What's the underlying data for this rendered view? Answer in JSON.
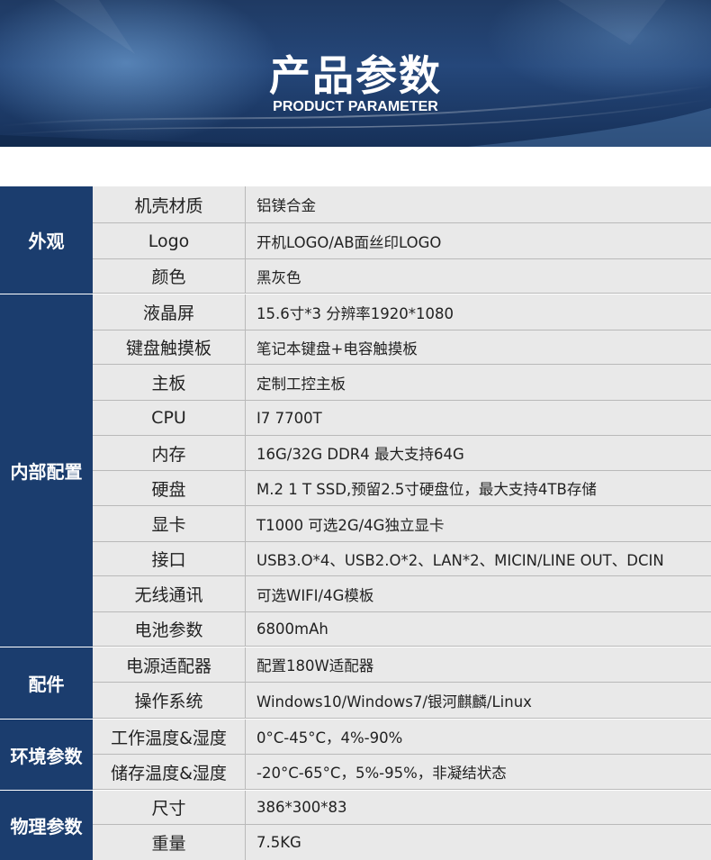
{
  "header": {
    "title": "产品参数",
    "subtitle": "PRODUCT PARAMETER"
  },
  "spec_groups": [
    {
      "category": "外观",
      "rows": [
        {
          "label": "机壳材质",
          "value": "铝镁合金"
        },
        {
          "label": "Logo",
          "value": "开机LOGO/AB面丝印LOGO"
        },
        {
          "label": "颜色",
          "value": "黑灰色"
        }
      ]
    },
    {
      "category": "内部配置",
      "rows": [
        {
          "label": "液晶屏",
          "value": "15.6寸*3 分辨率1920*1080"
        },
        {
          "label": "键盘触摸板",
          "value": "笔记本键盘+电容触摸板"
        },
        {
          "label": "主板",
          "value": "定制工控主板"
        },
        {
          "label": "CPU",
          "value": "I7 7700T"
        },
        {
          "label": "内存",
          "value": "16G/32G DDR4 最大支持64G"
        },
        {
          "label": "硬盘",
          "value": "M.2 1 T SSD,预留2.5寸硬盘位，最大支持4TB存储"
        },
        {
          "label": "显卡",
          "value": "T1000 可选2G/4G独立显卡"
        },
        {
          "label": "接口",
          "value": "USB3.O*4、USB2.O*2、LAN*2、MICIN/LINE OUT、DCIN"
        },
        {
          "label": "无线通讯",
          "value": "可选WIFI/4G模板"
        },
        {
          "label": "电池参数",
          "value": "6800mAh"
        }
      ]
    },
    {
      "category": "配件",
      "rows": [
        {
          "label": "电源适配器",
          "value": "配置180W适配器"
        },
        {
          "label": "操作系统",
          "value": "Windows10/Windows7/银河麒麟/Linux"
        }
      ]
    },
    {
      "category": "环境参数",
      "rows": [
        {
          "label": "工作温度&湿度",
          "value": "0°C-45°C，4%-90%"
        },
        {
          "label": "储存温度&湿度",
          "value": "-20°C-65°C，5%-95%，非凝结状态"
        }
      ]
    },
    {
      "category": "物理参数",
      "rows": [
        {
          "label": "尺寸",
          "value": "386*300*83"
        },
        {
          "label": "重量",
          "value": "7.5KG"
        }
      ]
    }
  ]
}
